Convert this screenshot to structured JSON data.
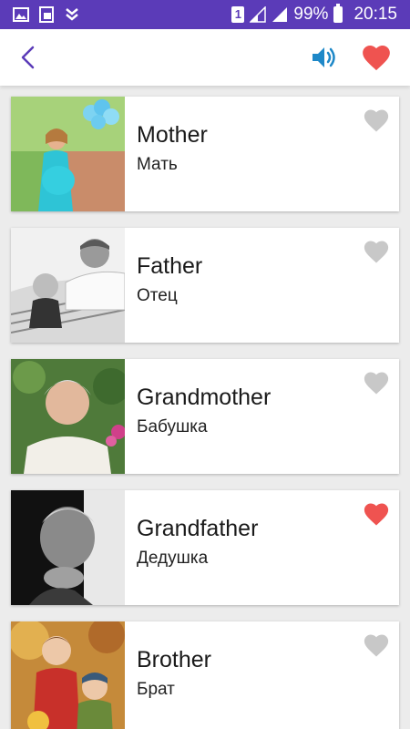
{
  "status_bar": {
    "sim_number": "1",
    "battery": "99%",
    "time": "20:15"
  },
  "app_bar": {
    "icons": [
      "back-arrow",
      "speaker",
      "heart"
    ],
    "accent_color": "#5b3bb8",
    "sound_color": "#1e88c8",
    "favorite_color": "#ef5350"
  },
  "words": [
    {
      "word": "Mother",
      "translation": "Мать",
      "favorite": false
    },
    {
      "word": "Father",
      "translation": "Отец",
      "favorite": false
    },
    {
      "word": "Grandmother",
      "translation": "Бабушка",
      "favorite": false
    },
    {
      "word": "Grandfather",
      "translation": "Дедушка",
      "favorite": true
    },
    {
      "word": "Brother",
      "translation": "Брат",
      "favorite": false
    }
  ]
}
